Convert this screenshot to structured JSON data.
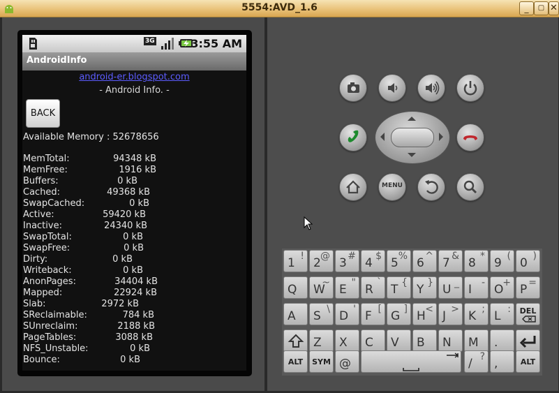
{
  "window": {
    "title": "5554:AVD_1.6"
  },
  "status": {
    "network": "3G",
    "time": "3:55 AM"
  },
  "app": {
    "title": "AndroidInfo",
    "link": "android-er.blogspot.com",
    "subtitle": "- Android Info. -",
    "back_label": "BACK",
    "available_memory": "Available Memory : 52678656",
    "meminfo": [
      {
        "key": "MemTotal:",
        "value": "94348 kB"
      },
      {
        "key": "MemFree:",
        "value": "1916 kB"
      },
      {
        "key": "Buffers:",
        "value": "0 kB"
      },
      {
        "key": "Cached:",
        "value": "49368 kB"
      },
      {
        "key": "SwapCached:",
        "value": "0 kB"
      },
      {
        "key": "Active:",
        "value": "59420 kB"
      },
      {
        "key": "Inactive:",
        "value": "24340 kB"
      },
      {
        "key": "SwapTotal:",
        "value": "0 kB"
      },
      {
        "key": "SwapFree:",
        "value": "0 kB"
      },
      {
        "key": "Dirty:",
        "value": "0 kB"
      },
      {
        "key": "Writeback:",
        "value": "0 kB"
      },
      {
        "key": "AnonPages:",
        "value": "34404 kB"
      },
      {
        "key": "Mapped:",
        "value": "22924 kB"
      },
      {
        "key": "Slab:",
        "value": "2972 kB"
      },
      {
        "key": "SReclaimable:",
        "value": "784 kB"
      },
      {
        "key": "SUnreclaim:",
        "value": "2188 kB"
      },
      {
        "key": "PageTables:",
        "value": "3088 kB"
      },
      {
        "key": "NFS_Unstable:",
        "value": "0 kB"
      },
      {
        "key": "Bounce:",
        "value": "0 kB"
      }
    ]
  },
  "emulator_controls": {
    "menu_label": "MENU"
  },
  "keyboard": {
    "row1": [
      [
        "1",
        "!"
      ],
      [
        "2",
        "@"
      ],
      [
        "3",
        "#"
      ],
      [
        "4",
        "$"
      ],
      [
        "5",
        "%"
      ],
      [
        "6",
        "^"
      ],
      [
        "7",
        "&"
      ],
      [
        "8",
        "*"
      ],
      [
        "9",
        "("
      ],
      [
        "0",
        ")"
      ]
    ],
    "row2": [
      [
        "Q",
        ""
      ],
      [
        "W",
        "~"
      ],
      [
        "E",
        "\""
      ],
      [
        "R",
        "`"
      ],
      [
        "T",
        "{"
      ],
      [
        "Y",
        "}"
      ],
      [
        "U",
        "_"
      ],
      [
        "I",
        "-"
      ],
      [
        "O",
        "+"
      ],
      [
        "P",
        "="
      ]
    ],
    "row3": [
      [
        "A",
        ""
      ],
      [
        "S",
        "\\"
      ],
      [
        "D",
        "'"
      ],
      [
        "F",
        "["
      ],
      [
        "G",
        "]"
      ],
      [
        "H",
        "<"
      ],
      [
        "J",
        ">"
      ],
      [
        "K",
        ";"
      ],
      [
        "L",
        ":"
      ],
      [
        "DEL",
        ""
      ]
    ],
    "row4": [
      [
        "",
        ""
      ],
      [
        "Z",
        ""
      ],
      [
        "X",
        ""
      ],
      [
        "C",
        ""
      ],
      [
        "V",
        ""
      ],
      [
        "B",
        ""
      ],
      [
        "N",
        ""
      ],
      [
        "M",
        ""
      ],
      [
        ".",
        ""
      ],
      [
        "",
        ""
      ]
    ],
    "row5_alt": "ALT",
    "row5_sym": "SYM",
    "row5_at": "@",
    "row5_slash": "/",
    "row5_slash_alt": "?",
    "row5_comma": ",",
    "row5_alt2": "ALT"
  }
}
